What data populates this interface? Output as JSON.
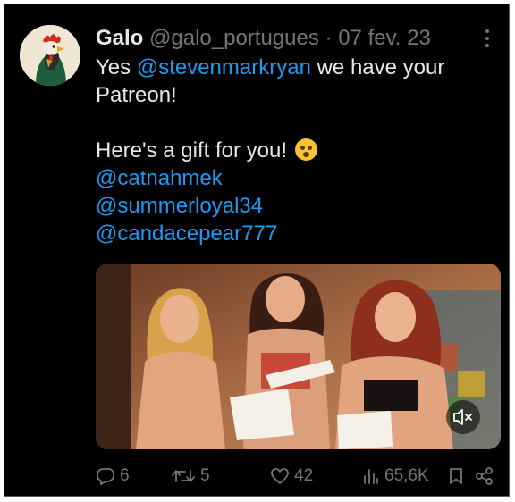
{
  "tweet": {
    "display_name": "Galo",
    "handle": "@galo_portugues",
    "separator": "·",
    "date": "07 fev. 23",
    "text": {
      "line1_prefix": "Yes ",
      "line1_mention": "@stevenmarkryan",
      "line1_suffix": " we have your",
      "line2": "Patreon!",
      "line4": "Here's a gift for you!",
      "mentions": [
        "@catnahmek",
        "@summerloyal34",
        "@candacepear777"
      ]
    },
    "emoji": "flushed-face-emoji"
  },
  "actions": {
    "replies": "6",
    "reposts": "5",
    "likes": "42",
    "views": "65,6K"
  },
  "icons": {
    "reply": "reply-icon",
    "repost": "repost-icon",
    "like": "heart-icon",
    "views": "views-chart-icon",
    "bookmark": "bookmark-icon",
    "share": "share-icon",
    "more": "more-options-icon",
    "mute": "muted-speaker-icon"
  },
  "colors": {
    "background": "#000000",
    "text": "#e7e9ea",
    "secondary": "#71767b",
    "mention": "#1d9bf0"
  }
}
